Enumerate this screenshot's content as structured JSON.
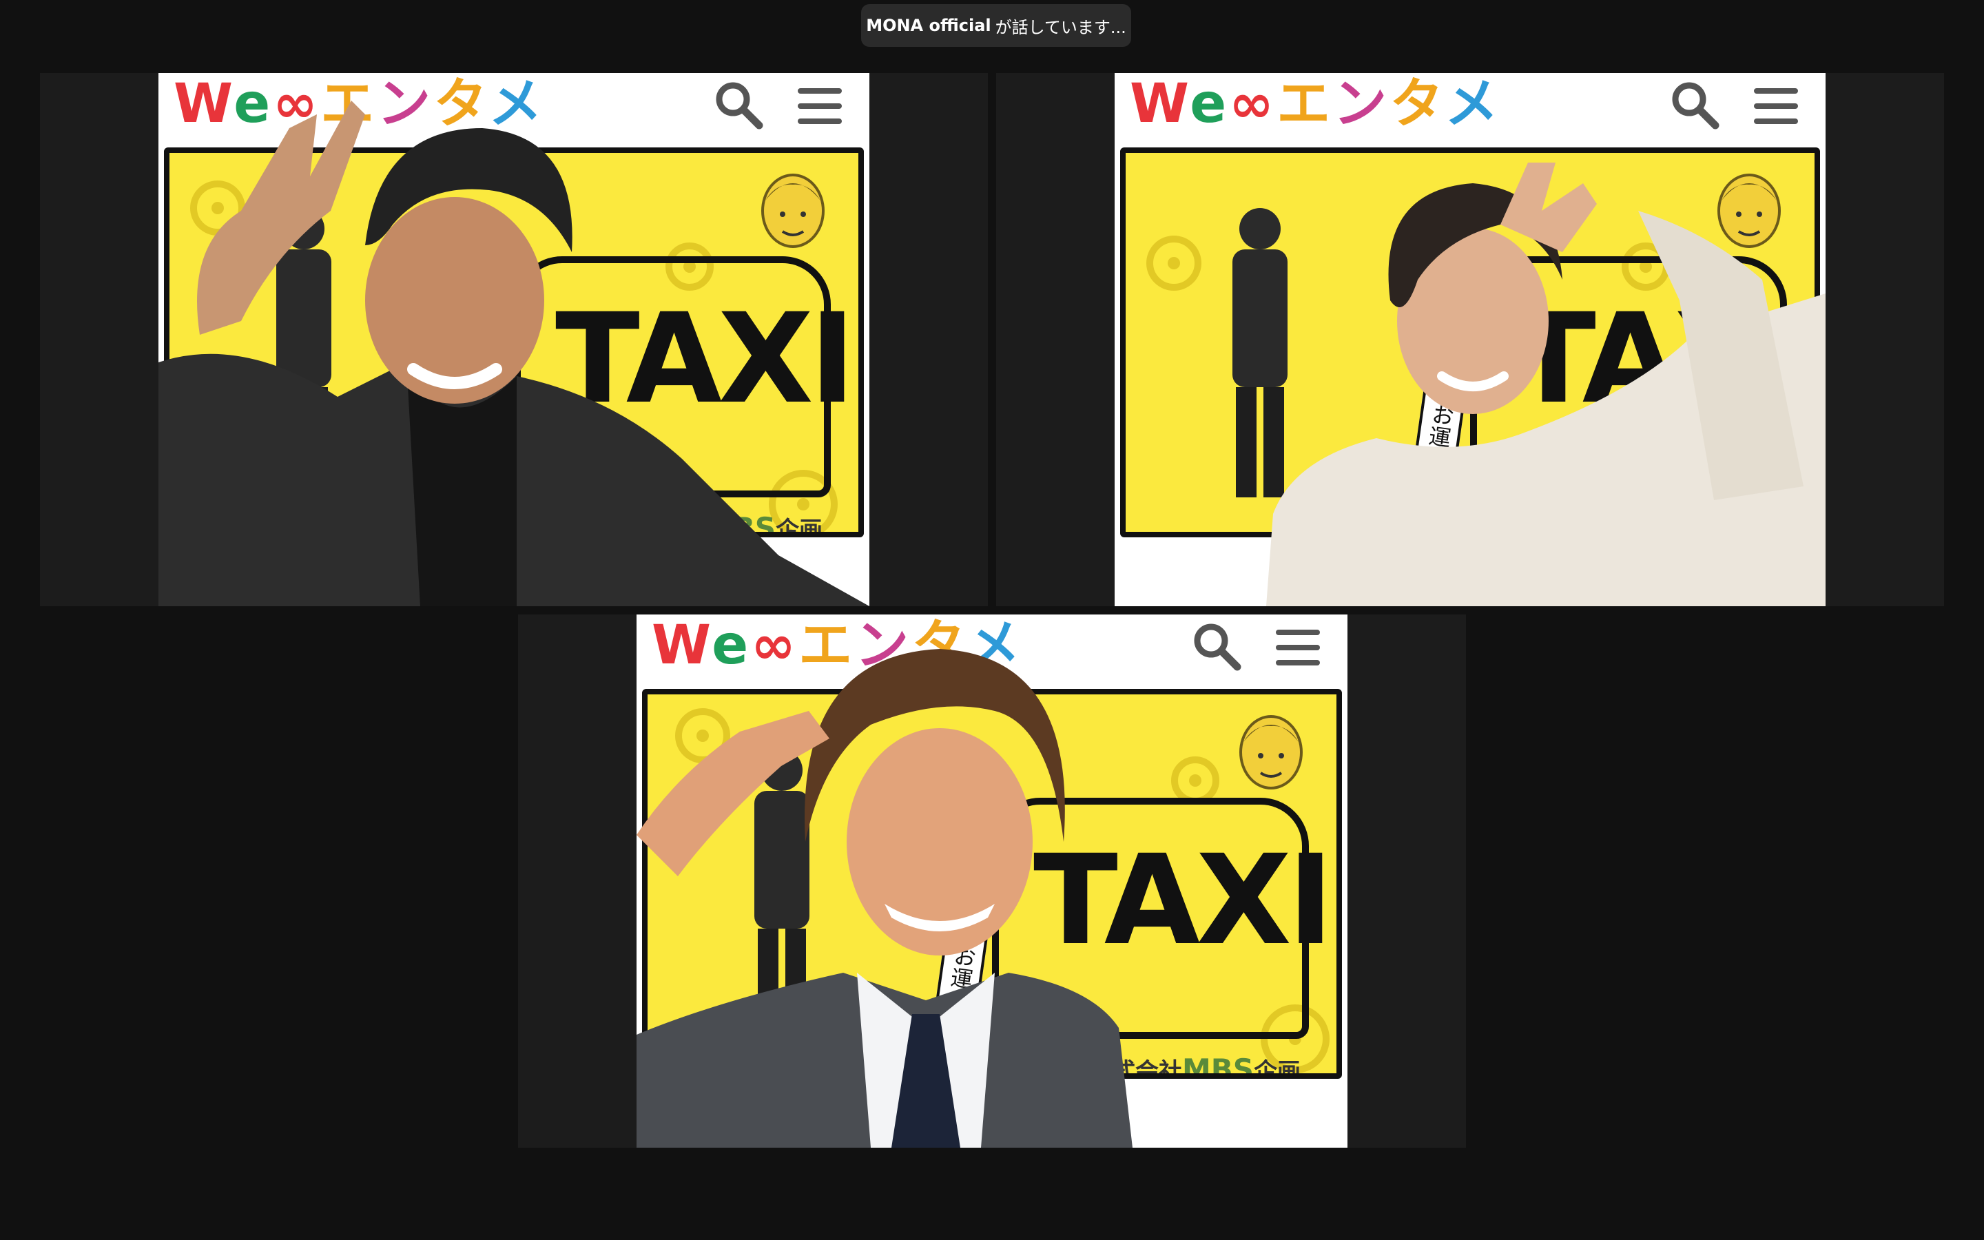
{
  "speaking_banner": {
    "speaker_name": "MONA official",
    "status_text": "が話しています..."
  },
  "virtual_background": {
    "logo_text": [
      "W",
      "e",
      "∞",
      "エ",
      "ン",
      "タ",
      "メ"
    ],
    "taxi_text": "TAXI",
    "vertical_text": "心を込めてお運びしま",
    "company_prefix": "株式会社",
    "company_brand": "MBS",
    "company_suffix": "企画"
  },
  "participants": [
    {
      "position": "top-left",
      "description": "man in dark shirt"
    },
    {
      "position": "top-right",
      "description": "woman in cream sweater"
    },
    {
      "position": "bottom-center",
      "description": "man in grey suit"
    }
  ],
  "colors": {
    "window_bg": "#111111",
    "tile_bg": "#1c1c1c",
    "poster_yellow": "#fbe93e",
    "banner_bg": "#2b2b2b"
  }
}
